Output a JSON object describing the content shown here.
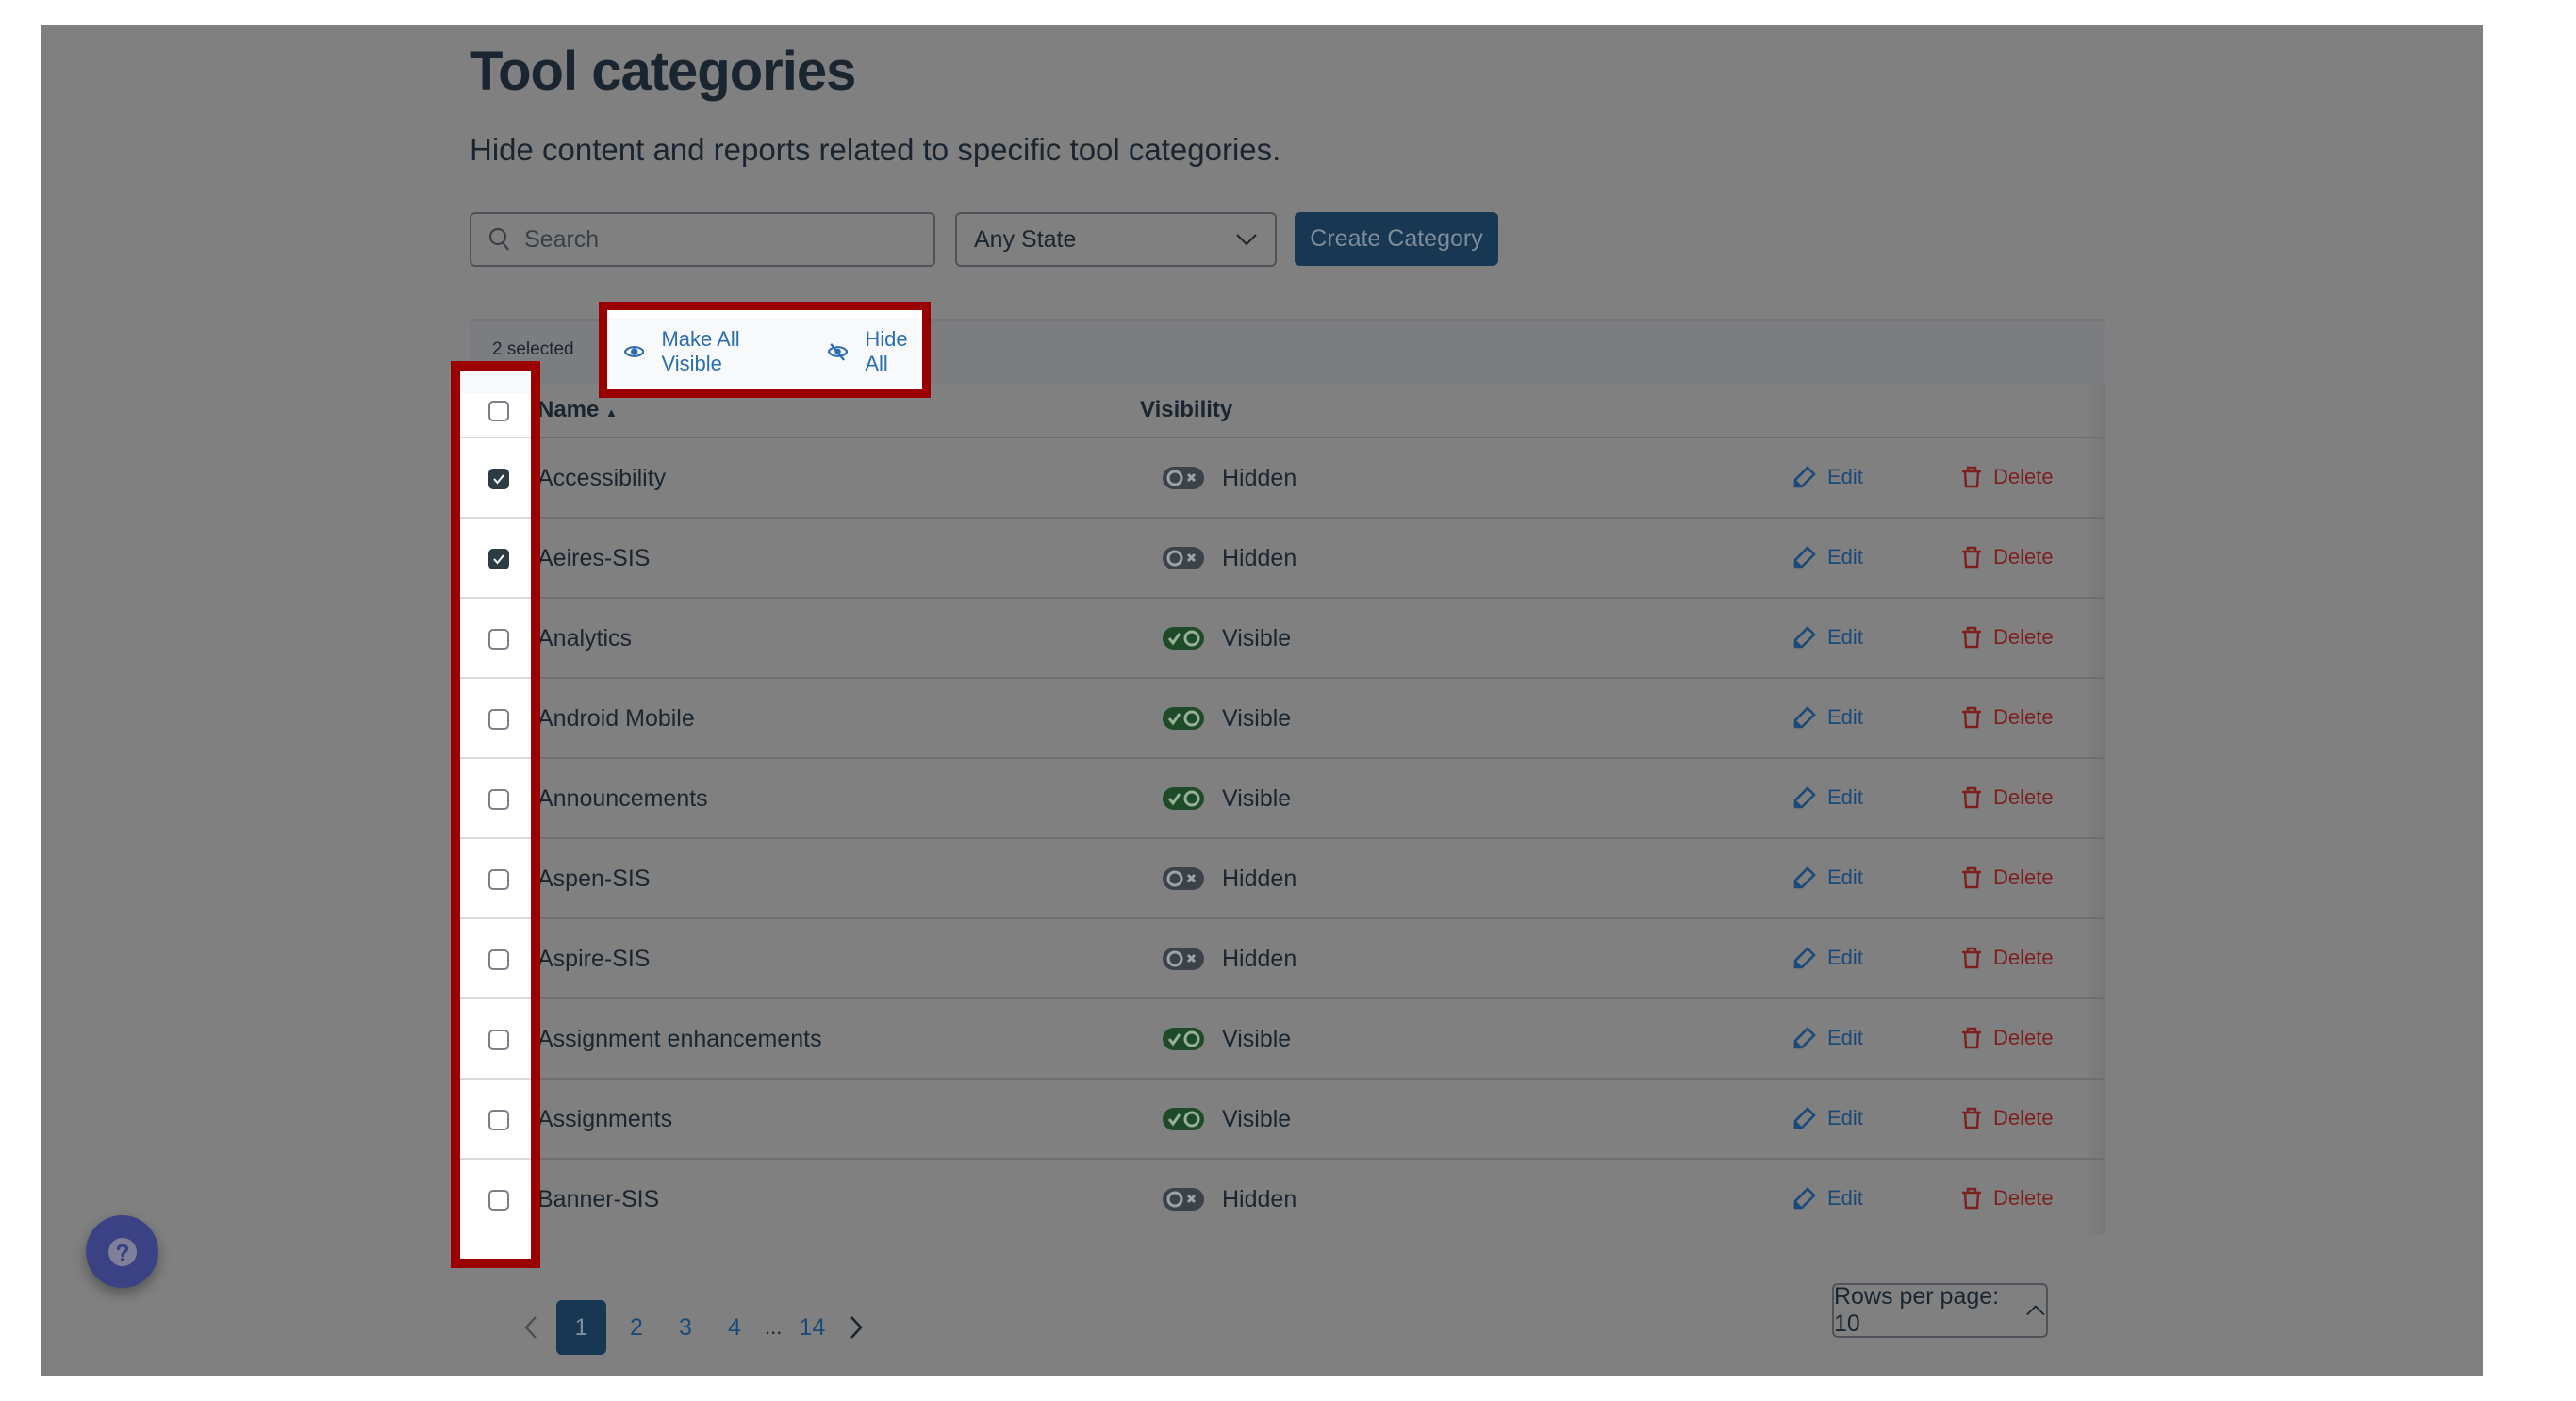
{
  "page": {
    "title": "Tool categories",
    "subtitle": "Hide content and reports related to specific tool categories."
  },
  "toolbar": {
    "search_placeholder": "Search",
    "search_value": "",
    "state_filter": "Any State",
    "create_label": "Create Category"
  },
  "bulk": {
    "selected_text": "2 selected",
    "make_visible_label": "Make All Visible",
    "hide_all_label": "Hide All"
  },
  "table": {
    "columns": {
      "name": "Name",
      "sort_indicator": "▲",
      "visibility": "Visibility"
    },
    "edit_label": "Edit",
    "delete_label": "Delete",
    "rows": [
      {
        "name": "Accessibility",
        "state": "off",
        "visibility": "Hidden",
        "checked": true
      },
      {
        "name": "Aeires-SIS",
        "state": "off",
        "visibility": "Hidden",
        "checked": true
      },
      {
        "name": "Analytics",
        "state": "on",
        "visibility": "Visible",
        "checked": false
      },
      {
        "name": "Android Mobile",
        "state": "on",
        "visibility": "Visible",
        "checked": false
      },
      {
        "name": "Announcements",
        "state": "on",
        "visibility": "Visible",
        "checked": false
      },
      {
        "name": "Aspen-SIS",
        "state": "off",
        "visibility": "Hidden",
        "checked": false
      },
      {
        "name": "Aspire-SIS",
        "state": "off",
        "visibility": "Hidden",
        "checked": false
      },
      {
        "name": "Assignment enhancements",
        "state": "on",
        "visibility": "Visible",
        "checked": false
      },
      {
        "name": "Assignments",
        "state": "on",
        "visibility": "Visible",
        "checked": false
      },
      {
        "name": "Banner-SIS",
        "state": "off",
        "visibility": "Hidden",
        "checked": false
      }
    ]
  },
  "pagination": {
    "pages": [
      "1",
      "2",
      "3",
      "4"
    ],
    "ellipsis": "...",
    "last_page": "14",
    "current": "1",
    "rows_per_page_label": "Rows per page: 10"
  },
  "help": {
    "icon": "question-icon"
  },
  "colors": {
    "highlight": "#9b0000",
    "primary": "#173753",
    "link": "#2b6db3",
    "danger": "#7d2020",
    "toggle_on": "#1e4a27",
    "toggle_off": "#3c4249"
  }
}
